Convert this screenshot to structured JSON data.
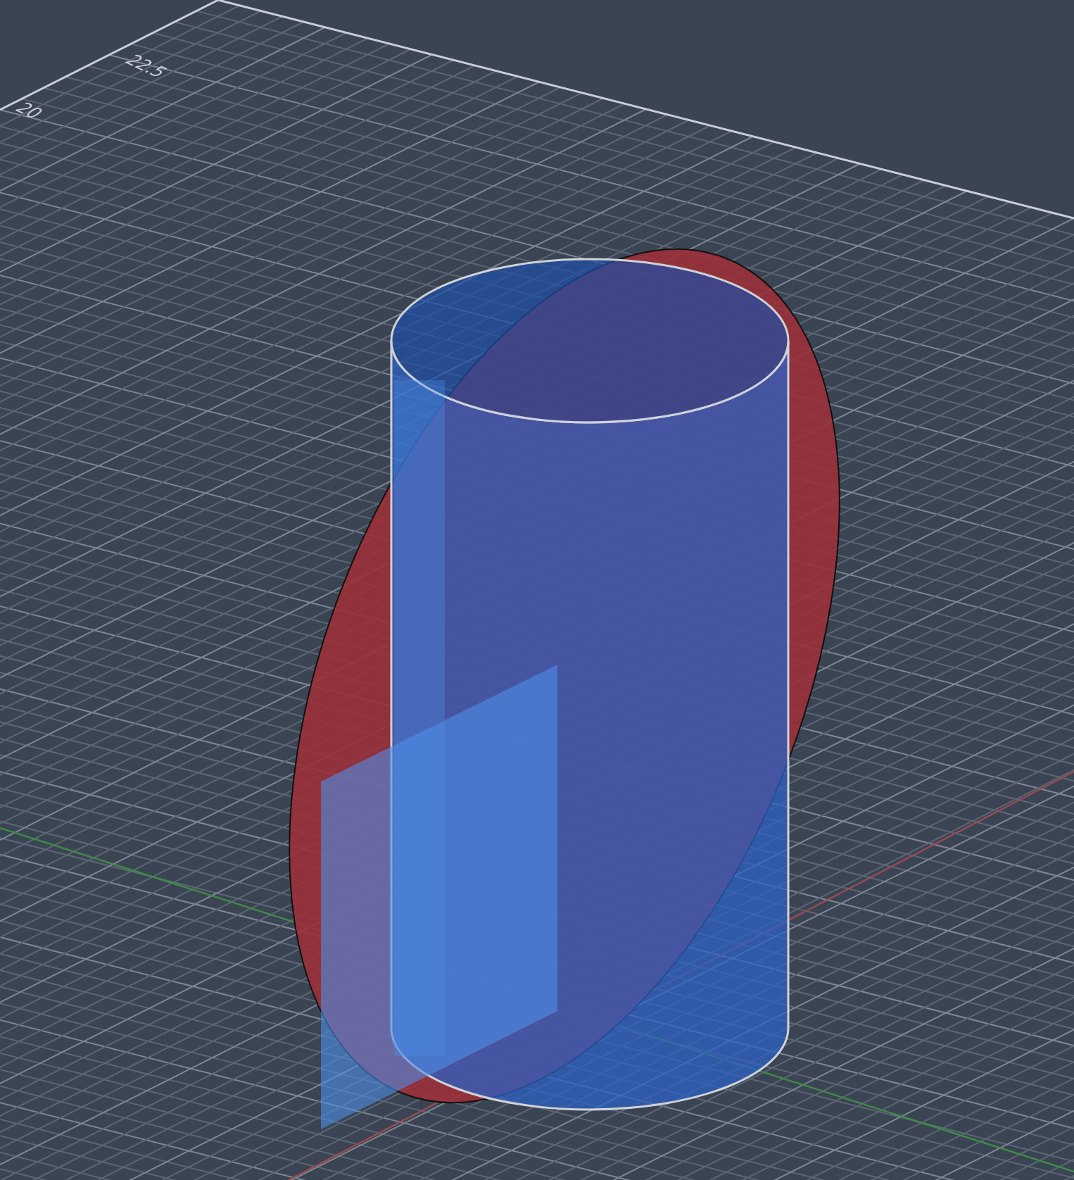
{
  "viewport": {
    "grid_labels": [
      {
        "text": "22.5"
      },
      {
        "text": "20"
      }
    ]
  }
}
